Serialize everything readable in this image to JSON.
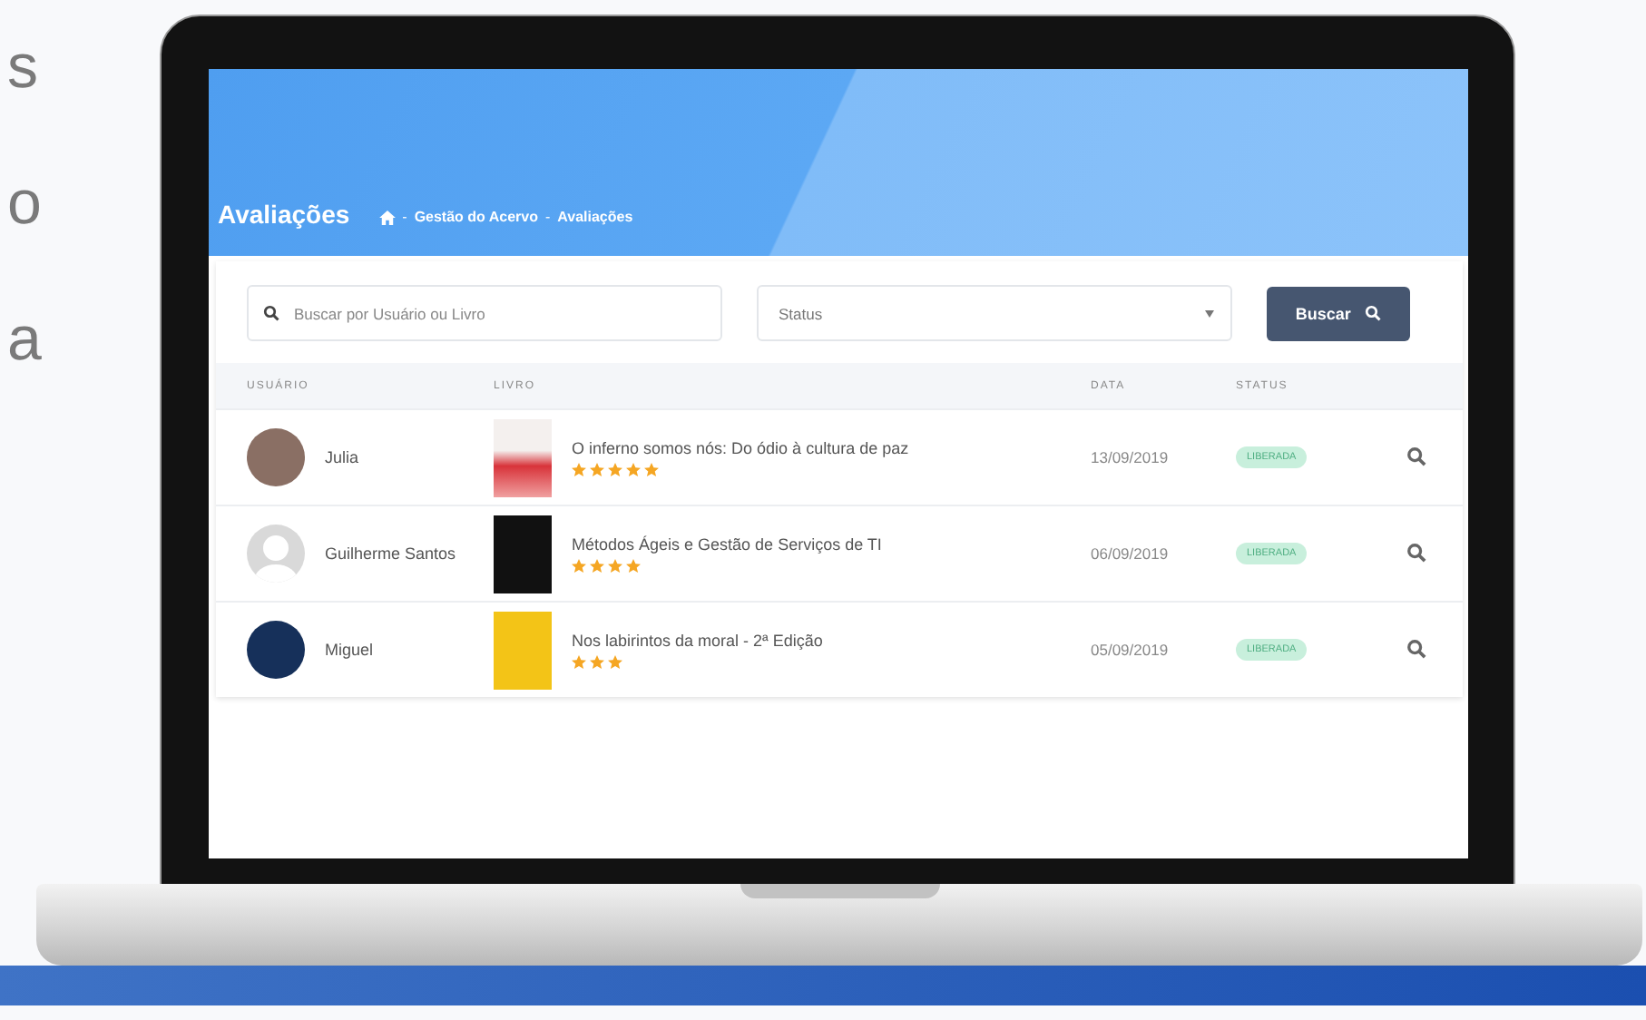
{
  "side_text_lines": [
    "s",
    "o",
    "a"
  ],
  "page": {
    "title": "Avaliações",
    "breadcrumb": [
      "Gestão do Acervo",
      "Avaliações"
    ],
    "breadcrumb_separator": "-"
  },
  "filters": {
    "search": {
      "placeholder": "Buscar por Usuário ou Livro"
    },
    "status_select": {
      "value": "Status"
    },
    "search_button": "Buscar"
  },
  "table": {
    "columns": [
      "USUÁRIO",
      "LIVRO",
      "DATA",
      "STATUS"
    ],
    "rows": [
      {
        "user": "Julia",
        "kind": "photo",
        "book": "O inferno somos nós: Do ódio à cultura de paz",
        "stars": 5,
        "date": "13/09/2019",
        "status": "LIBERADA"
      },
      {
        "user": "Guilherme Santos",
        "kind": "silhouette",
        "book": "Métodos Ágeis e Gestão de Serviços de TI",
        "stars": 4,
        "date": "06/09/2019",
        "status": "LIBERADA"
      },
      {
        "user": "Miguel",
        "kind": "logo",
        "book": "Nos labirintos da moral - 2ª Edição",
        "stars": 3,
        "date": "05/09/2019",
        "status": "LIBERADA"
      }
    ]
  }
}
